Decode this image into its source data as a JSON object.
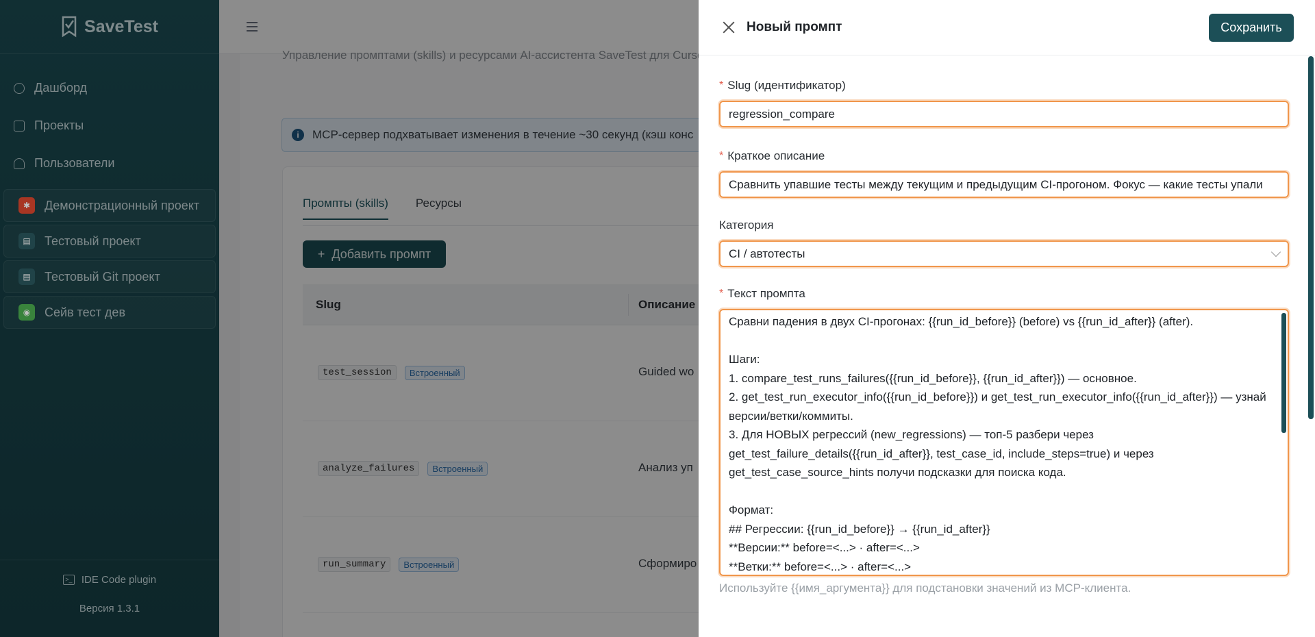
{
  "app": {
    "name": "SaveTest",
    "version": "Версия 1.3.1",
    "plugin": "IDE Code plugin"
  },
  "nav": [
    {
      "label": "Дашборд",
      "icon": "dashboard-icon"
    },
    {
      "label": "Проекты",
      "icon": "projects-icon"
    },
    {
      "label": "Пользователи",
      "icon": "users-icon"
    }
  ],
  "projects": [
    {
      "label": "Демонстрационный проект",
      "color": "#e0482f",
      "icon": "bug-icon"
    },
    {
      "label": "Тестовый проект",
      "color": "#2b5a60",
      "icon": "clipboard-icon"
    },
    {
      "label": "Тестовый Git проект",
      "color": "#2b5a60",
      "icon": "clipboard-icon"
    },
    {
      "label": "Сейв тест дев",
      "color": "#4caf50",
      "icon": "android-icon"
    }
  ],
  "page": {
    "subtitle": "Управление промптами (skills) и ресурсами AI-ассистента SaveTest для Curso",
    "alert": "MCP-сервер подхватывает изменения в течение ~30 секунд (кэш конс",
    "tabs": [
      "Промпты (skills)",
      "Ресурсы"
    ],
    "add_button": "Добавить промпт",
    "columns": [
      "Slug",
      "Описание"
    ],
    "rows": [
      {
        "slug": "test_session",
        "tag": "Встроенный",
        "desc": "Guided wo"
      },
      {
        "slug": "analyze_failures",
        "tag": "Встроенный",
        "desc": "Анализ уп"
      },
      {
        "slug": "run_summary",
        "tag": "Встроенный",
        "desc": "Сформиро"
      }
    ]
  },
  "drawer": {
    "title": "Новый промпт",
    "save": "Сохранить",
    "slug_label": "Slug (идентификатор)",
    "slug_value": "regression_compare",
    "desc_label": "Краткое описание",
    "desc_value": "Сравнить упавшие тесты между текущим и предыдущим CI-прогоном. Фокус — какие тесты упали",
    "category_label": "Категория",
    "category_value": "CI / автотесты",
    "text_label": "Текст промпта",
    "text_lines": [
      "Сравни падения в двух CI-прогонах: {{run_id_before}} (before) vs {{run_id_after}} (after).",
      "",
      "Шаги:",
      "1. compare_test_runs_failures({{run_id_before}}, {{run_id_after}}) — основное.",
      "2. get_test_run_executor_info({{run_id_before}}) и get_test_run_executor_info({{run_id_after}}) — узнай",
      "версии/ветки/коммиты.",
      "3. Для НОВЫХ регрессий (new_regressions) — топ-5 разбери через",
      "get_test_failure_details({{run_id_after}}, test_case_id, include_steps=true) и через",
      "get_test_case_source_hints получи подсказки для поиска кода.",
      "",
      "Формат:",
      "## Регрессии: {{run_id_before}} → {{run_id_after}}",
      "**Версии:** before=<...> · after=<...>",
      "**Ветки:** before=<...> · after=<...>"
    ],
    "hint": "Используйте {{имя_аргумента}} для подстановки значений из MCP-клиента."
  }
}
